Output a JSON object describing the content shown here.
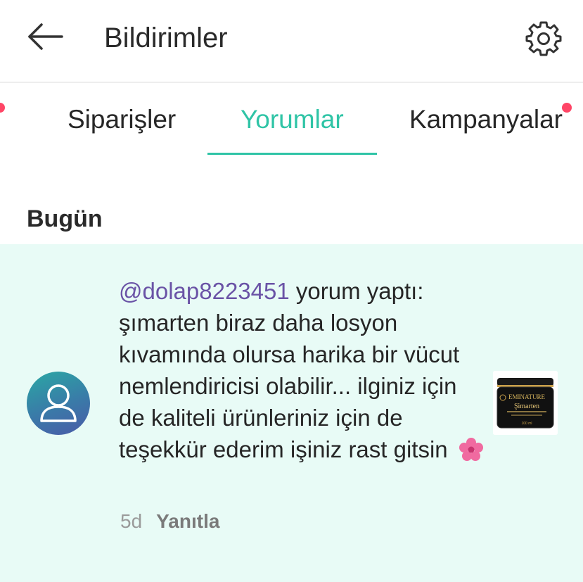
{
  "header": {
    "title": "Bildirimler",
    "back_icon": "arrow-left-icon",
    "settings_icon": "gear-icon"
  },
  "tabs": [
    {
      "label": "Siparişler",
      "active": false,
      "has_dot": true
    },
    {
      "label": "Yorumlar",
      "active": true,
      "has_dot": false
    },
    {
      "label": "Kampanyalar",
      "active": false,
      "has_dot": true
    }
  ],
  "colors": {
    "accent": "#2fc4a6",
    "notification_dot": "#ff4566",
    "card_background": "#e8fbf6",
    "mention": "#6a53a6"
  },
  "section": {
    "title": "Bugün"
  },
  "notification": {
    "avatar_icon": "user-icon",
    "mention": "@dolap8223451",
    "text": " yorum yaptı: şımarten biraz daha losyon kıvamında olursa harika bir vücut nemlendiricisi olabilir... ilginiz için de kaliteli ürünleriniz için de teşekkür ederim işiniz rast gitsin",
    "emoji_icon": "cherry-blossom-icon",
    "time": "5d",
    "reply_label": "Yanıtla",
    "product": {
      "brand": "EMINATURE",
      "name": "Şimarten",
      "volume": "100 ml"
    }
  }
}
